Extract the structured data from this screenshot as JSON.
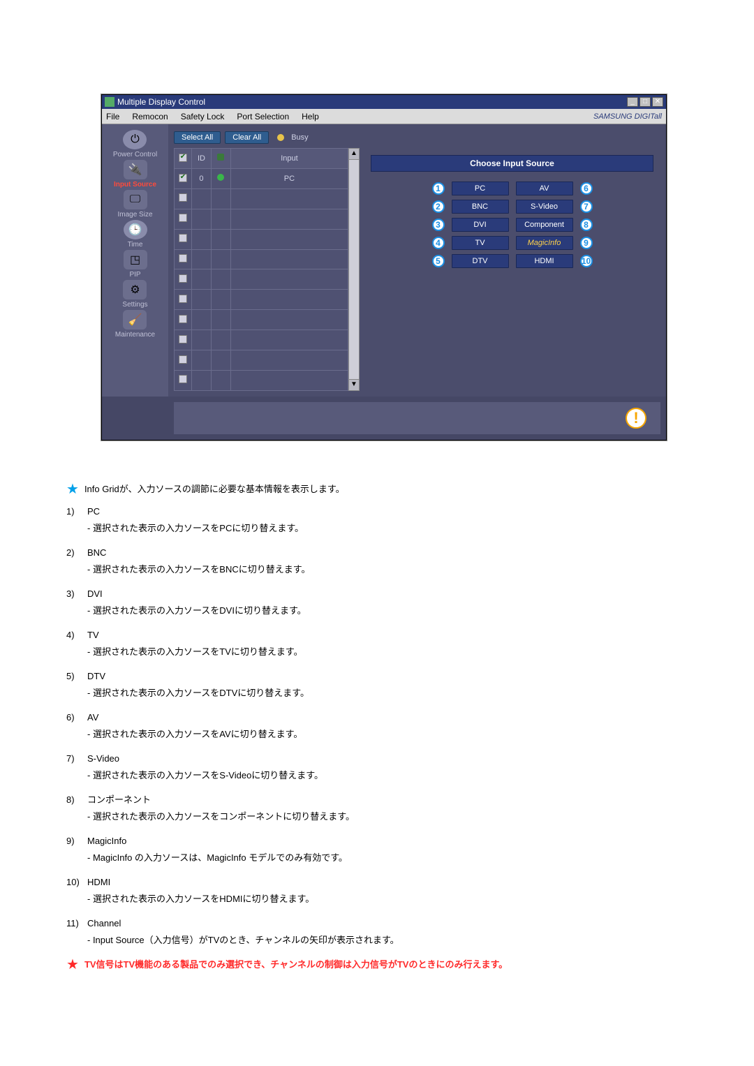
{
  "window": {
    "title": "Multiple Display Control",
    "window_controls": {
      "minimize": "_",
      "maximize": "□",
      "close": "✕"
    }
  },
  "menubar": {
    "items": [
      "File",
      "Remocon",
      "Safety Lock",
      "Port Selection",
      "Help"
    ],
    "brand": "SAMSUNG DIGITall"
  },
  "sidebar": {
    "items": [
      {
        "label": "Power Control",
        "active": false
      },
      {
        "label": "Input Source",
        "active": true
      },
      {
        "label": "Image Size",
        "active": false
      },
      {
        "label": "Time",
        "active": false
      },
      {
        "label": "PIP",
        "active": false
      },
      {
        "label": "Settings",
        "active": false
      },
      {
        "label": "Maintenance",
        "active": false
      }
    ]
  },
  "toolbar": {
    "select_all": "Select All",
    "clear_all": "Clear All",
    "busy": "Busy"
  },
  "grid": {
    "headers": {
      "chk": "",
      "id": "ID",
      "led": "",
      "input": "Input"
    },
    "rows": [
      {
        "checked": true,
        "id": "0",
        "led": true,
        "input": "PC"
      },
      {
        "checked": false,
        "id": "",
        "led": false,
        "input": ""
      },
      {
        "checked": false,
        "id": "",
        "led": false,
        "input": ""
      },
      {
        "checked": false,
        "id": "",
        "led": false,
        "input": ""
      },
      {
        "checked": false,
        "id": "",
        "led": false,
        "input": ""
      },
      {
        "checked": false,
        "id": "",
        "led": false,
        "input": ""
      },
      {
        "checked": false,
        "id": "",
        "led": false,
        "input": ""
      },
      {
        "checked": false,
        "id": "",
        "led": false,
        "input": ""
      },
      {
        "checked": false,
        "id": "",
        "led": false,
        "input": ""
      },
      {
        "checked": false,
        "id": "",
        "led": false,
        "input": ""
      },
      {
        "checked": false,
        "id": "",
        "led": false,
        "input": ""
      }
    ]
  },
  "panel": {
    "title": "Choose Input Source",
    "sources_left": [
      {
        "num": "1",
        "label": "PC"
      },
      {
        "num": "2",
        "label": "BNC"
      },
      {
        "num": "3",
        "label": "DVI"
      },
      {
        "num": "4",
        "label": "TV"
      },
      {
        "num": "5",
        "label": "DTV"
      }
    ],
    "sources_right": [
      {
        "num": "6",
        "label": "AV"
      },
      {
        "num": "7",
        "label": "S-Video"
      },
      {
        "num": "8",
        "label": "Component"
      },
      {
        "num": "9",
        "label": "MagicInfo",
        "magic": true
      },
      {
        "num": "10",
        "label": "HDMI"
      }
    ]
  },
  "description": {
    "intro": "Info Gridが、入力ソースの調節に必要な基本情報を表示します。",
    "items": [
      {
        "num": "1)",
        "title": "PC",
        "desc": "- 選択された表示の入力ソースをPCに切り替えます。"
      },
      {
        "num": "2)",
        "title": "BNC",
        "desc": "- 選択された表示の入力ソースをBNCに切り替えます。"
      },
      {
        "num": "3)",
        "title": "DVI",
        "desc": "- 選択された表示の入力ソースをDVIに切り替えます。"
      },
      {
        "num": "4)",
        "title": "TV",
        "desc": "- 選択された表示の入力ソースをTVに切り替えます。"
      },
      {
        "num": "5)",
        "title": "DTV",
        "desc": "- 選択された表示の入力ソースをDTVに切り替えます。"
      },
      {
        "num": "6)",
        "title": "AV",
        "desc": "- 選択された表示の入力ソースをAVに切り替えます。"
      },
      {
        "num": "7)",
        "title": "S-Video",
        "desc": "- 選択された表示の入力ソースをS-Videoに切り替えます。"
      },
      {
        "num": "8)",
        "title": "コンポーネント",
        "desc": "- 選択された表示の入力ソースをコンポーネントに切り替えます。"
      },
      {
        "num": "9)",
        "title": "MagicInfo",
        "desc": "- MagicInfo の入力ソースは、MagicInfo モデルでのみ有効です。"
      },
      {
        "num": "10)",
        "title": "HDMI",
        "desc": "- 選択された表示の入力ソースをHDMIに切り替えます。"
      },
      {
        "num": "11)",
        "title": "Channel",
        "desc": "- Input Source（入力信号）がTVのとき、チャンネルの矢印が表示されます。"
      }
    ],
    "footnote": "TV信号はTV機能のある製品でのみ選択でき、チャンネルの制御は入力信号がTVのときにのみ行えます。"
  }
}
